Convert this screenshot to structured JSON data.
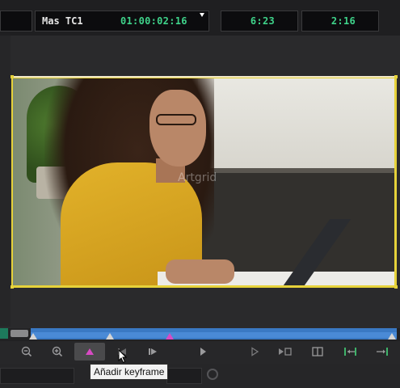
{
  "timecode_bar": {
    "mode_label": "Mas TC1",
    "master_timecode": "01:00:02:16",
    "readout_1": "6:23",
    "readout_2": "2:16"
  },
  "viewer": {
    "watermark": "Artgrid"
  },
  "timeline": {
    "accent_color": "#3a79c4",
    "keyframe_color": "#d84ac4"
  },
  "toolbar": {
    "buttons": [
      {
        "name": "zoom-out",
        "icon": "zoom-out-icon"
      },
      {
        "name": "zoom-in",
        "icon": "zoom-in-icon"
      },
      {
        "name": "add-keyframe",
        "icon": "add-keyframe-icon",
        "active": true
      },
      {
        "name": "prev-keyframe",
        "icon": "prev-keyframe-icon"
      },
      {
        "name": "next-keyframe",
        "icon": "next-keyframe-icon"
      },
      {
        "name": "play",
        "icon": "play-icon"
      },
      {
        "name": "play-outline",
        "icon": "play-outline-icon"
      },
      {
        "name": "loop-play",
        "icon": "loop-icon"
      },
      {
        "name": "split-view",
        "icon": "split-view-icon"
      },
      {
        "name": "mark-in",
        "icon": "mark-in-icon"
      },
      {
        "name": "mark-out",
        "icon": "mark-out-icon"
      }
    ]
  },
  "tooltip": {
    "text": "Añadir keyframe"
  }
}
